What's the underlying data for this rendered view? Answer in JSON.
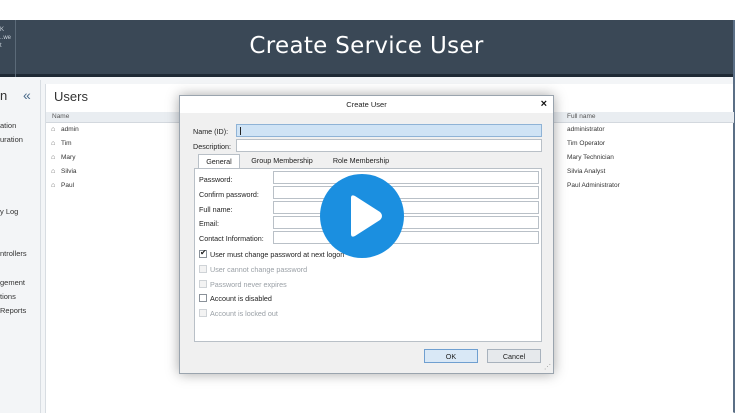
{
  "banner": {
    "title": "Create Service User"
  },
  "sidebar": {
    "heading": "n",
    "collapse_icon": "«",
    "items": [
      {
        "label": "ation"
      },
      {
        "label": "uration"
      },
      {
        "label": "y Log"
      },
      {
        "label": "ntrollers"
      },
      {
        "label": "gement"
      },
      {
        "label": "tions"
      },
      {
        "label": "Reports"
      }
    ]
  },
  "main": {
    "title": "Users",
    "columns": {
      "name": "Name",
      "full_name": "Full name"
    },
    "rows": [
      {
        "name": "admin",
        "full_name": "administrator"
      },
      {
        "name": "Tim",
        "full_name": "Tim Operator"
      },
      {
        "name": "Mary",
        "full_name": "Mary Technician"
      },
      {
        "name": "Silvia",
        "full_name": "Silvia Analyst"
      },
      {
        "name": "Paul",
        "full_name": "Paul Administrator"
      }
    ]
  },
  "dialog": {
    "title": "Create User",
    "close_icon": "×",
    "name_label": "Name (ID):",
    "name_value": "",
    "description_label": "Description:",
    "tabs": [
      "General",
      "Group Membership",
      "Role Membership"
    ],
    "fields": [
      {
        "label": "Password:"
      },
      {
        "label": "Confirm password:"
      },
      {
        "label": "Full name:"
      },
      {
        "label": "Email:"
      },
      {
        "label": "Contact Information:"
      }
    ],
    "checkboxes": [
      {
        "label": "User must change password at next logon",
        "checked": true,
        "enabled": true
      },
      {
        "label": "User cannot change password",
        "checked": false,
        "enabled": false
      },
      {
        "label": "Password never expires",
        "checked": false,
        "enabled": false
      },
      {
        "label": "Account is disabled",
        "checked": false,
        "enabled": true
      },
      {
        "label": "Account is locked out",
        "checked": false,
        "enabled": false
      }
    ],
    "ok_label": "OK",
    "cancel_label": "Cancel"
  },
  "overlay": {
    "icon": "play-icon",
    "color": "#1b8fe0"
  }
}
